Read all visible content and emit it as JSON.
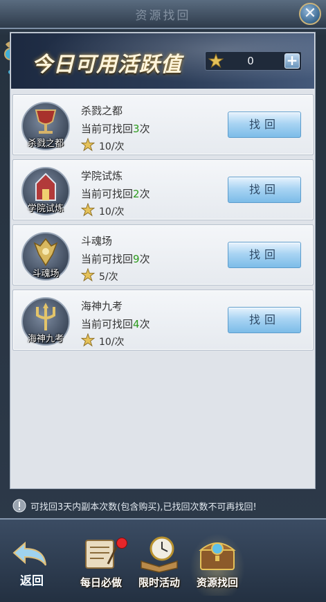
{
  "window": {
    "title": "资源找回",
    "close_icon": "close-icon"
  },
  "banner": {
    "title": "今日可用活跃值",
    "points_value": "0",
    "plus_label": "+"
  },
  "rows": [
    {
      "name": "杀戮之都",
      "icon_label": "杀戮之都",
      "remain_prefix": "当前可找回",
      "remain_count": "3",
      "remain_suffix": "次",
      "cost": "10/次",
      "button": "找回"
    },
    {
      "name": "学院试炼",
      "icon_label": "学院试炼",
      "remain_prefix": "当前可找回",
      "remain_count": "2",
      "remain_suffix": "次",
      "cost": "10/次",
      "button": "找回"
    },
    {
      "name": "斗魂场",
      "icon_label": "斗魂场",
      "remain_prefix": "当前可找回",
      "remain_count": "9",
      "remain_suffix": "次",
      "cost": "5/次",
      "button": "找回"
    },
    {
      "name": "海神九考",
      "icon_label": "海神九考",
      "remain_prefix": "当前可找回",
      "remain_count": "4",
      "remain_suffix": "次",
      "cost": "10/次",
      "button": "找回"
    }
  ],
  "notice": "可找回3天内副本次数(包含购买),已找回次数不可再找回!",
  "bottom_nav": {
    "back": "返回",
    "tabs": [
      {
        "label": "每日必做",
        "badge": true
      },
      {
        "label": "限时活动",
        "badge": false
      },
      {
        "label": "资源找回",
        "badge": false,
        "active": true
      }
    ]
  },
  "colors": {
    "remain_count": "#2c9a1c",
    "button": "#a9d4f3",
    "banner_title": "#fff5dc"
  }
}
